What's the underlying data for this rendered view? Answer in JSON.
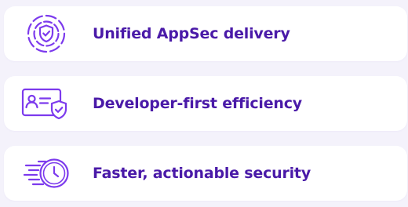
{
  "accent_color": "#4a1aa8",
  "icon_color": "#7c3aed",
  "features": [
    {
      "icon": "shield-gear-icon",
      "label": "Unified AppSec delivery"
    },
    {
      "icon": "id-card-shield-icon",
      "label": "Developer-first efficiency"
    },
    {
      "icon": "fast-clock-icon",
      "label": "Faster, actionable security"
    }
  ]
}
